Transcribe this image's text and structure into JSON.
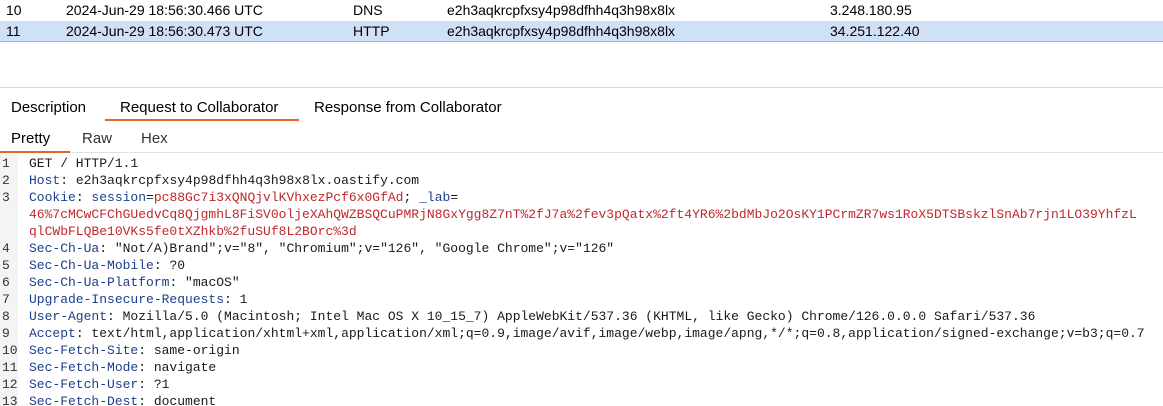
{
  "interactions_table": {
    "rows": [
      {
        "num": "10",
        "time": "2024-Jun-29 18:56:30.466 UTC",
        "type": "DNS",
        "payload": "e2h3aqkrcpfxsy4p98dfhh4q3h98x8lx",
        "source": "3.248.180.95"
      },
      {
        "num": "11",
        "time": "2024-Jun-29 18:56:30.473 UTC",
        "type": "HTTP",
        "payload": "e2h3aqkrcpfxsy4p98dfhh4q3h98x8lx",
        "source": "34.251.122.40"
      }
    ],
    "selected_row": "11"
  },
  "detail_tabs": {
    "description": "Description",
    "request": "Request to Collaborator",
    "response": "Response from Collaborator",
    "active": "Request to Collaborator"
  },
  "view_tabs": {
    "pretty": "Pretty",
    "raw": "Raw",
    "hex": "Hex",
    "active": "Pretty"
  },
  "request_lines": [
    {
      "n": "1",
      "key": "GET / HTTP/1.1",
      "sep": "",
      "val": ""
    },
    {
      "n": "2",
      "key": "Host",
      "sep": ": ",
      "val": "e2h3aqkrcpfxsy4p98dfhh4q3h98x8lx.oastify.com"
    },
    {
      "n": "3",
      "key": "Cookie",
      "sep": ": ",
      "val": "",
      "cookie1_name": "session",
      "cookie1_val": "pc88Gc7i3xQNQjvlKVhxezPcf6x0GfAd",
      "cookie2_name": "_lab",
      "cookie2_val_a": "46%7cMCwCFChGUedvCq8QjgmhL8FiSV0oljeXAhQWZBSQCuPMRjN8GxYgg8Z7nT%2fJ7a%2fev3pQatx%2ft4YR6%2bdMbJo2OsKY1PCrmZR7ws1RoX5DTSBskzlSnAb7rjn1LO39YhfzL",
      "cookie2_val_b": "qlCWbFLQBe10VKs5fe0tXZhkb%2fuSUf8L2BOrc%3d"
    },
    {
      "n": "4",
      "key": "Sec-Ch-Ua",
      "sep": ": ",
      "val": "\"Not/A)Brand\";v=\"8\", \"Chromium\";v=\"126\", \"Google Chrome\";v=\"126\""
    },
    {
      "n": "5",
      "key": "Sec-Ch-Ua-Mobile",
      "sep": ": ",
      "val": "?0"
    },
    {
      "n": "6",
      "key": "Sec-Ch-Ua-Platform",
      "sep": ": ",
      "val": "\"macOS\""
    },
    {
      "n": "7",
      "key": "Upgrade-Insecure-Requests",
      "sep": ": ",
      "val": "1"
    },
    {
      "n": "8",
      "key": "User-Agent",
      "sep": ": ",
      "val": "Mozilla/5.0 (Macintosh; Intel Mac OS X 10_15_7) AppleWebKit/537.36 (KHTML, like Gecko) Chrome/126.0.0.0 Safari/537.36"
    },
    {
      "n": "9",
      "key": "Accept",
      "sep": ": ",
      "val": "text/html,application/xhtml+xml,application/xml;q=0.9,image/avif,image/webp,image/apng,*/*;q=0.8,application/signed-exchange;v=b3;q=0.7"
    },
    {
      "n": "10",
      "key": "Sec-Fetch-Site",
      "sep": ": ",
      "val": "same-origin"
    },
    {
      "n": "11",
      "key": "Sec-Fetch-Mode",
      "sep": ": ",
      "val": "navigate"
    },
    {
      "n": "12",
      "key": "Sec-Fetch-User",
      "sep": ": ",
      "val": "?1"
    },
    {
      "n": "13",
      "key": "Sec-Fetch-Dest",
      "sep": ": ",
      "val": "document"
    }
  ],
  "colors": {
    "accent": "#e8612c",
    "selected_row": "#cfe0f7",
    "header_key": "#1d3e8e",
    "cookie_value": "#c0272d"
  }
}
